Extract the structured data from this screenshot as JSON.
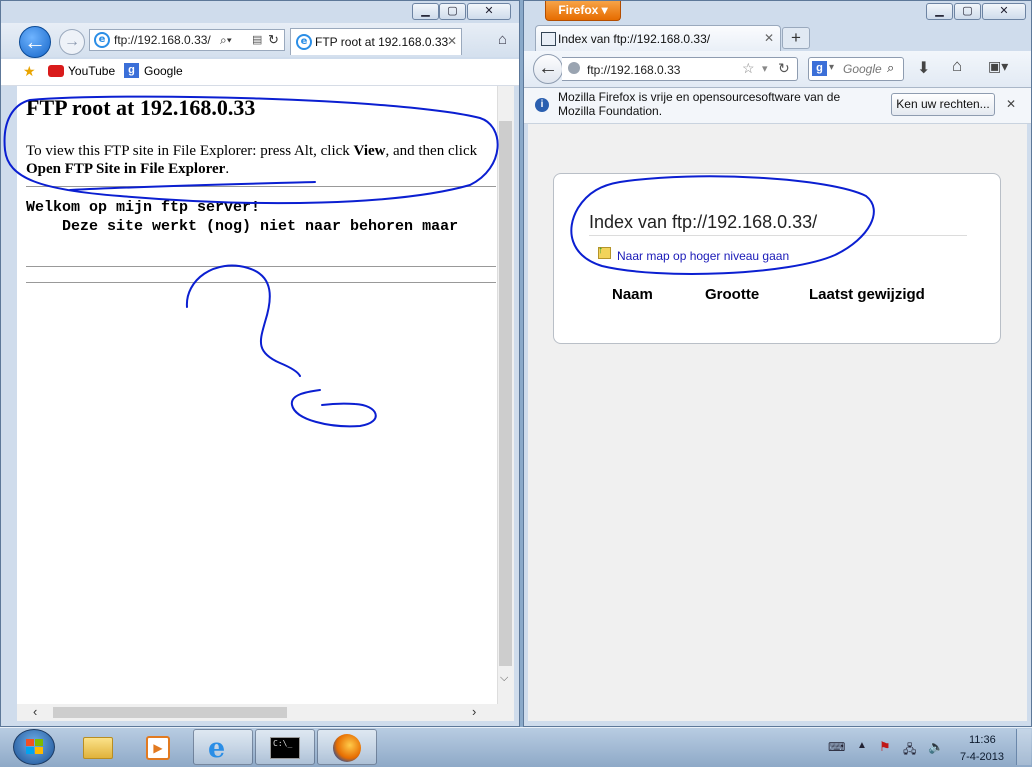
{
  "ie": {
    "address_url": "ftp://192.168.0.33/",
    "address_display": "ftp://192.168.0.33/",
    "tab_title": "FTP root at 192.168.0.33",
    "favorites": [
      {
        "label": "YouTube",
        "icon": "youtube-icon"
      },
      {
        "label": "Google",
        "icon": "google-icon"
      }
    ],
    "page": {
      "heading": "FTP root at 192.168.0.33",
      "hint_pre": "To view this FTP site in File Explorer: press Alt, click ",
      "hint_view": "View",
      "hint_mid": ", and then click ",
      "hint_open": "Open FTP Site in File Explorer",
      "hint_end": ".",
      "welcome_line1": "Welkom op mijn ftp server!",
      "welcome_line2": "    Deze site werkt (nog) niet naar behoren maar ",
      "ellipsis": "…"
    }
  },
  "firefox": {
    "menu_button": "Firefox",
    "tab_title": "Index van ftp://192.168.0.33/",
    "url": "ftp://192.168.0.33",
    "search_placeholder": "Google",
    "notification": "Mozilla Firefox is vrije en opensourcesoftware van de Mozilla Foundation.",
    "notification_button": "Ken uw rechten...",
    "page": {
      "title": "Index van ftp://192.168.0.33/",
      "up_link": "Naar map op hoger niveau gaan",
      "columns": [
        "Naam",
        "Grootte",
        "Laatst gewijzigd"
      ]
    }
  },
  "taskbar": {
    "apps": [
      {
        "name": "explorer",
        "icon": "folder-icon"
      },
      {
        "name": "media",
        "icon": "media-player-icon"
      },
      {
        "name": "ie",
        "icon": "internet-explorer-icon",
        "active": true
      },
      {
        "name": "cmd",
        "icon": "command-prompt-icon",
        "active": true
      },
      {
        "name": "firefox",
        "icon": "firefox-icon",
        "active": true
      }
    ],
    "time": "11:36",
    "date": "7-4-2013"
  },
  "accent": {
    "annotation_ink": "#0b1fd1",
    "firefox_orange": "#e66c00",
    "link_blue": "#1a1ab8"
  }
}
